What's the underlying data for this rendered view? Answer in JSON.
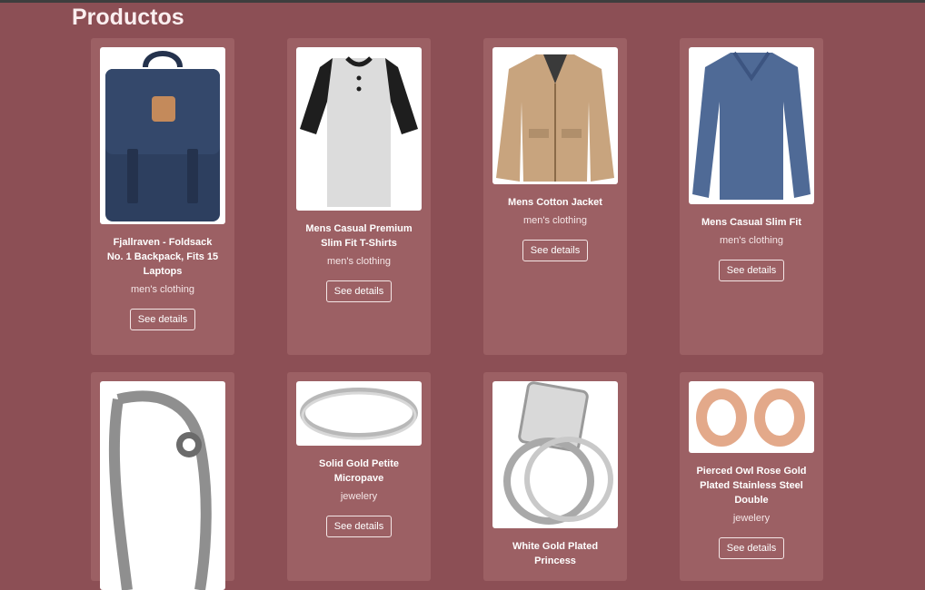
{
  "page": {
    "title": "Productos"
  },
  "products": [
    {
      "title": "Fjallraven - Foldsack No. 1 Backpack, Fits 15 Laptops",
      "category": "men's clothing",
      "button": "See details",
      "icon": "backpack"
    },
    {
      "title": "Mens Casual Premium Slim Fit T-Shirts",
      "category": "men's clothing",
      "button": "See details",
      "icon": "raglan-tshirt"
    },
    {
      "title": "Mens Cotton Jacket",
      "category": "men's clothing",
      "button": "See details",
      "icon": "jacket"
    },
    {
      "title": "Mens Casual Slim Fit",
      "category": "men's clothing",
      "button": "See details",
      "icon": "long-sleeve-shirt"
    },
    {
      "title": "",
      "category": "",
      "button": "",
      "icon": "bracelet"
    },
    {
      "title": "Solid Gold Petite Micropave",
      "category": "jewelery",
      "button": "See details",
      "icon": "ring"
    },
    {
      "title": "White Gold Plated Princess",
      "category": "",
      "button": "",
      "icon": "engagement-ring"
    },
    {
      "title": "Pierced Owl Rose Gold Plated Stainless Steel Double",
      "category": "jewelery",
      "button": "See details",
      "icon": "tunnel-plugs"
    }
  ]
}
